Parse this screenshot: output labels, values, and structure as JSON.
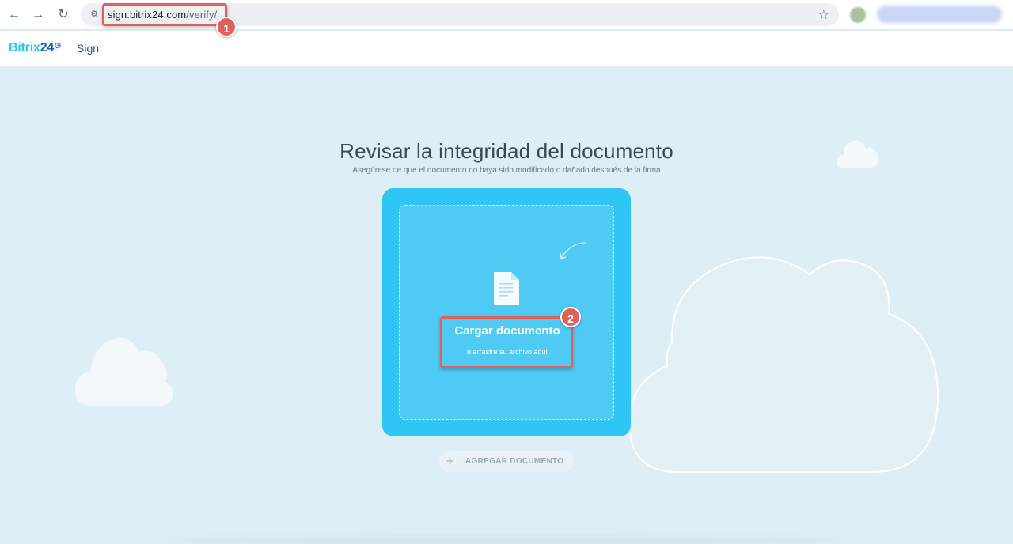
{
  "browser": {
    "back_icon": "←",
    "forward_icon": "→",
    "reload_icon": "↻",
    "site_info_icon": "⚙",
    "url_host": "sign.bitrix24.com",
    "url_path": "/verify/",
    "star_icon": "☆"
  },
  "header": {
    "logo_main": "Bitrix",
    "logo_num": "24",
    "logo_clock": "◷",
    "product": "Sign"
  },
  "main": {
    "title": "Revisar la integridad del documento",
    "subtitle": "Asegúrese de que el documento no haya sido modificado o dañado después de la firma",
    "upload_title": "Cargar documento",
    "upload_sub": "o arrastre su archivo aquí",
    "add_button_label": "AGREGAR DOCUMENTO",
    "add_button_icon": "+"
  },
  "annotations": {
    "badge_1": "1",
    "badge_2": "2",
    "color": "#e2605a"
  },
  "colors": {
    "accent": "#2fc6f6",
    "background": "#ddeef6",
    "logo_dark": "#0b66c3"
  }
}
